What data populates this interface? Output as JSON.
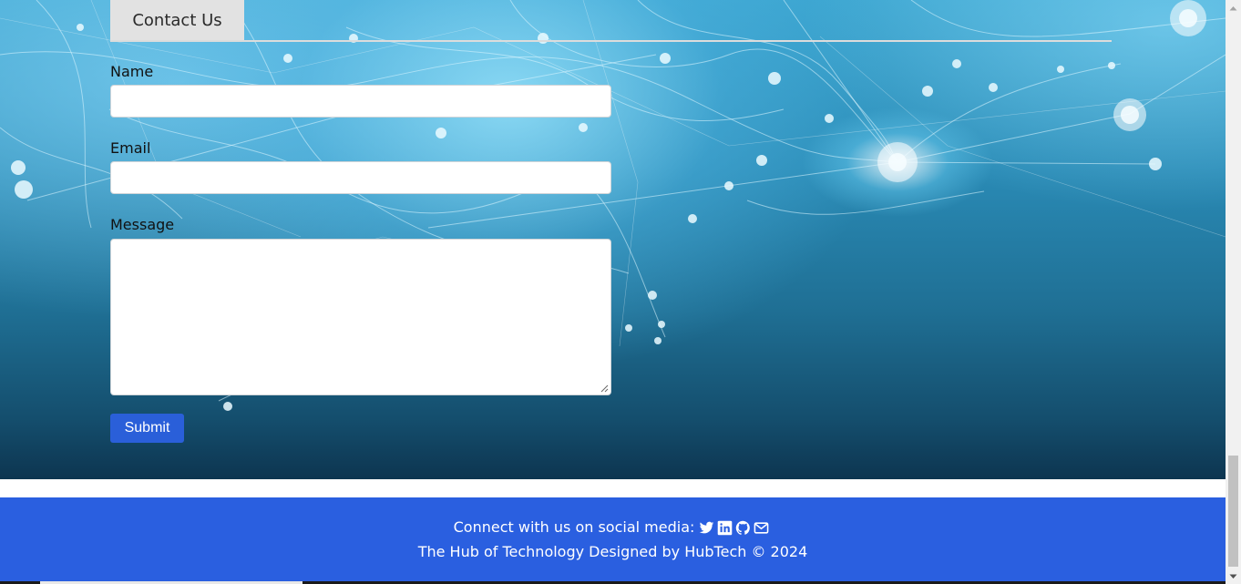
{
  "contact": {
    "tab_label": "Contact Us",
    "fields": {
      "name_label": "Name",
      "name_value": "",
      "email_label": "Email",
      "email_value": "",
      "message_label": "Message",
      "message_value": ""
    },
    "submit_label": "Submit"
  },
  "footer": {
    "social_text": "Connect with us on social media:",
    "social_icons": [
      "twitter-icon",
      "linkedin-icon",
      "github-icon",
      "envelope-icon"
    ],
    "credit_text": "The Hub of Technology Designed by HubTech © 2024"
  },
  "colors": {
    "footer_bg": "#2a5fe0",
    "submit_bg": "#2a5fd9",
    "tab_bg": "#e2e2e2"
  },
  "scroll": {
    "position_fraction": 1.0
  }
}
